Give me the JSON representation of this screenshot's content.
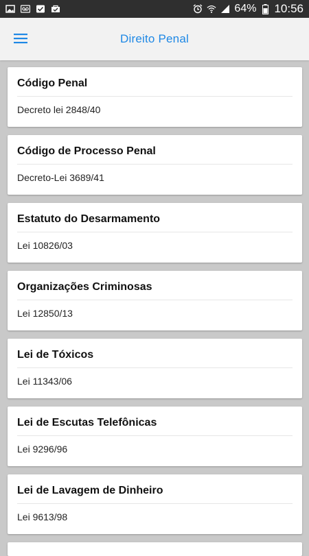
{
  "status_bar": {
    "icons_left": [
      "image-icon",
      "voicemail-icon",
      "checkbox-icon",
      "bag-check-icon"
    ],
    "icons_right": [
      "alarm-icon",
      "wifi-icon",
      "signal-icon"
    ],
    "battery": "64%",
    "time": "10:56"
  },
  "app_bar": {
    "title": "Direito Penal",
    "accent_color": "#1e88e5",
    "menu_icon": "hamburger-menu-icon"
  },
  "items": [
    {
      "title": "Código Penal",
      "subtitle": "Decreto lei 2848/40"
    },
    {
      "title": "Código de Processo Penal",
      "subtitle": "Decreto-Lei 3689/41"
    },
    {
      "title": "Estatuto do Desarmamento",
      "subtitle": "Lei 10826/03"
    },
    {
      "title": "Organizações Criminosas",
      "subtitle": "Lei 12850/13"
    },
    {
      "title": "Lei de Tóxicos",
      "subtitle": "Lei 11343/06"
    },
    {
      "title": "Lei de Escutas Telefônicas",
      "subtitle": "Lei 9296/96"
    },
    {
      "title": "Lei de Lavagem de Dinheiro",
      "subtitle": "Lei 9613/98"
    }
  ]
}
